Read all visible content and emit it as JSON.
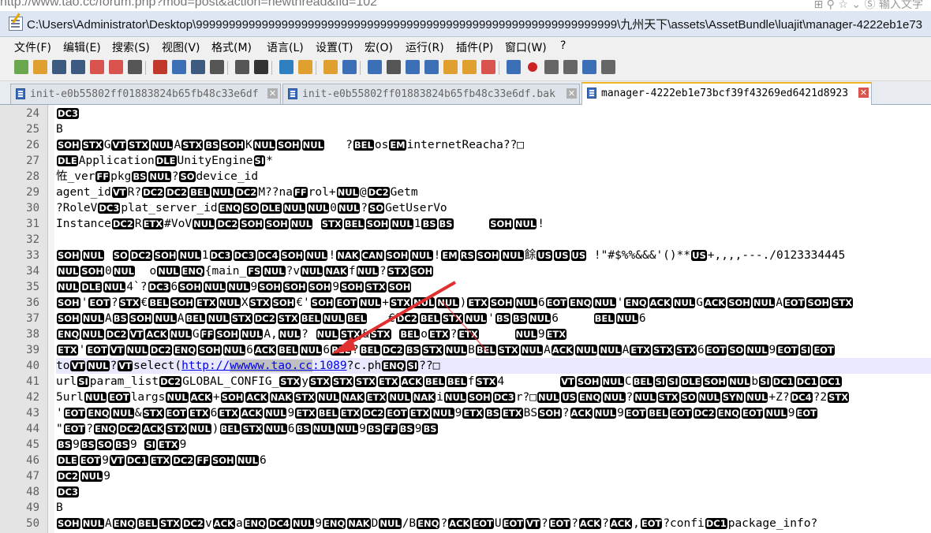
{
  "browser": {
    "url_fragment": "http://www.tao.cc/forum.php?mod=post&action=newthread&fid=102",
    "icons_text": "⊞  ⚲  ☆  ⌄  Ⓢ  输入文字"
  },
  "window": {
    "title": "C:\\Users\\Administrator\\Desktop\\9999999999999999999999999999999999999999999999999999999999999999\\九州天下\\assets\\AssetBundle\\luajit\\manager-4222eb1e73"
  },
  "menu": [
    "文件(F)",
    "编辑(E)",
    "搜索(S)",
    "视图(V)",
    "格式(M)",
    "语言(L)",
    "设置(T)",
    "宏(O)",
    "运行(R)",
    "插件(P)",
    "窗口(W)",
    "?"
  ],
  "toolbar_icons": [
    "new-file-icon",
    "open-file-icon",
    "save-icon",
    "save-all-icon",
    "close-icon",
    "close-all-icon",
    "print-icon",
    "cut-icon",
    "copy-icon",
    "paste-icon",
    "undo-icon",
    "redo-icon",
    "find-icon",
    "replace-icon",
    "zoom-in-icon",
    "zoom-out-icon",
    "sync-v-icon",
    "sync-h-icon",
    "word-wrap-icon",
    "show-all-chars-icon",
    "indent-guide-icon",
    "doc-map-icon",
    "function-list-icon",
    "folder-workspace-icon",
    "monitor-icon",
    "record-macro-icon",
    "stop-macro-icon",
    "play-macro-icon",
    "run-macro-multiple-icon",
    "save-macro-icon"
  ],
  "toolbar_colors": [
    "#6aa84f",
    "#e0a030",
    "#3d5a80",
    "#3d5a80",
    "#d9534f",
    "#d9534f",
    "#555555",
    "#c0392b",
    "#3d6fb6",
    "#3d5a80",
    "#555555",
    "#555555",
    "#333333",
    "#2f80c0",
    "#e0a030",
    "#e0a030",
    "#3d6fb6",
    "#3d6fb6",
    "#555555",
    "#3d6fb6",
    "#3d6fb6",
    "#e0a030",
    "#e0a030",
    "#d9534f",
    "#3d6fb6",
    "#cc2222",
    "#666666",
    "#666666",
    "#3d6fb6",
    "#666666"
  ],
  "tabs": [
    {
      "label": "init-e0b55802ff01883824b65fb48c33e6df",
      "active": false
    },
    {
      "label": "init-e0b55802ff01883824b65fb48c33e6df.bak",
      "active": false
    },
    {
      "label": "manager-4222eb1e73bcf39f43269ed6421d8923",
      "active": true
    }
  ],
  "colors": {
    "accent_tab": "#f0b429",
    "current_line": "#e8e8ff",
    "arrow": "#e03030"
  },
  "editor": {
    "lines": [
      {
        "n": "24",
        "t": "[DC3]"
      },
      {
        "n": "25",
        "t": "B"
      },
      {
        "n": "26",
        "t": "[SOH][STX]G[VT][STX][NUL]A[STX][BS][SOH]K[NUL][SOH][NUL]   ?[BEL]os[EM]internetReacha??□"
      },
      {
        "n": "27",
        "t": "[DLE]Application[DLE]UnityEngine[SI]*"
      },
      {
        "n": "28",
        "t": "恠_ver[FF]pkg[BS][NUL]?[SO]device_id"
      },
      {
        "n": "29",
        "t": "agent_id[VT]R?[DC2][DC2][BEL][NUL][DC2]M??na[FF]rol+[NUL]@[DC2]Getm"
      },
      {
        "n": "30",
        "t": "?RoleV[DC3]plat_server_id[ENQ][SO][DLE][NUL][NUL]0[NUL]?[SO]GetUserVo"
      },
      {
        "n": "31",
        "t": "Instance[DC2]R[ETX]#VoV[NUL][DC2][SOH][SOH][NUL] [STX][BEL][SOH][NUL]1[BS][BS]     [SOH][NUL]!"
      },
      {
        "n": "32",
        "t": ""
      },
      {
        "n": "33",
        "t": "[SOH][NUL] [SO][DC2][SOH][NUL]1[DC3][DC3][DC4][SOH][NUL]![NAK][CAN][SOH][NUL]![EM][RS][SOH][NUL]餘[US][US][US] !\"#$%%&&&'()**[US]+,,,,---./0123334445"
      },
      {
        "n": "34",
        "t": "[NUL][SOH]0[NUL]  o[NUL][ENQ]{main_[FS][NUL]?v[NUL][NAK]f[NUL]?[STX][SOH]"
      },
      {
        "n": "35",
        "t": "[NUL][DLE][NUL]4`?[DC3]6[SOH][NUL][NUL]9[SOH][SOH][SOH]9[SOH][STX][SOH]"
      },
      {
        "n": "36",
        "t": "[SOH]'[EOT]?[STX]€[BEL][SOH][ETX][NUL]X[STX][SOH]€'[SOH][EOT][NUL]+[STX][NUL][NUL])[ETX][SOH][NUL]6[EOT][ENQ][NUL]'[ENQ][ACK][NUL]G[ACK][SOH][NUL]A[EOT][SOH][STX]"
      },
      {
        "n": "37",
        "t": "[SOH][NUL]A[BS][SOH][NUL]A[BEL][NUL][STX][DC2][STX][BEL][NUL][BEL]   €[DC2][BEL][STX][NUL]'[BS][BS][NUL]6     [BEL][NUL]6"
      },
      {
        "n": "38",
        "t": "[ENQ][NUL][DC2][VT][ACK][NUL]G[FF][SOH][NUL]A,[NUL]? [NUL][STX]&[STX] [BEL]o[ETX]?[ETX]     [NUL]9[ETX]"
      },
      {
        "n": "39",
        "t": "[ETX]'[EOT][VT][NUL][DC2][ENQ][SOH][NUL]6[ACK][BEL][NUL]6[BEL]?[BEL][DC2][BS][STX][NUL]B[BEL][STX][NUL]A[ACK][NUL][NUL]A[ETX][STX][STX]6[EOT][SO][NUL]9[EOT][SI][EOT]"
      },
      {
        "n": "40",
        "t": "to[VT][NUL]?[VT]select(%%http://wwwww.tao.cc:1089%%?c.ph[ENQ][SI]??□",
        "current": true
      },
      {
        "n": "41",
        "t": "url[SI]param_list[DC2]GLOBAL_CONFIG_[STX]y[STX][STX][STX][ETX][ACK][BEL][BEL]f[STX]4        [VT][SOH][NUL]C[BEL][SI][SI][DLE][SOH][NUL]b[SI][DC1][DC1][DC1]"
      },
      {
        "n": "42",
        "t": "5url[NUL][EOT]largs[NUL][ACK]+[SOH][ACK][NAK][STX][NUL][NAK][ETX][NUL][NAK]i[NUL][SOH][DC3]r?□[NUL][US][ENQ][NUL]?[NUL][STX][SO][NUL][SYN][NUL]+Z?[DC4]?2[STX]"
      },
      {
        "n": "43",
        "t": "'[EOT][ENQ][NUL]&[STX][EOT][ETX]6[ETX][ACK][NUL]9[ETX][BEL][ETX][DC2][EOT][ETX][NUL]9[ETX][BS][ETX]BS[SOH]?[ACK][NUL]9[EOT][BEL][EOT][DC2][ENQ][EOT][NUL]9[EOT]"
      },
      {
        "n": "44",
        "t": "\"[EOT]?[ENQ][DC2][ACK][STX][NUL])[BEL][STX][NUL]6[BS][NUL][NUL]9[BS][FF][BS]9[BS]"
      },
      {
        "n": "45",
        "t": "[BS]9[BS][SO][BS]9 [SI][ETX]9"
      },
      {
        "n": "46",
        "t": "[DLE][EOT]9[VT][DC1][ETX][DC2][FF][SOH][NUL]6"
      },
      {
        "n": "47",
        "t": "[DC2][NUL]9"
      },
      {
        "n": "48",
        "t": "[DC3]"
      },
      {
        "n": "49",
        "t": "B"
      },
      {
        "n": "50",
        "t": "[SOH][NUL]A[ENQ][BEL][STX][DC2]v[ACK]a[ENQ][DC4][NUL]9[ENQ][NAK]D[NUL]/B[ENQ]?[ACK][EOT]U[EOT][VT]?[EOT]?[ACK]?[ACK],[EOT]?confi[DC1]package_info?"
      }
    ]
  }
}
